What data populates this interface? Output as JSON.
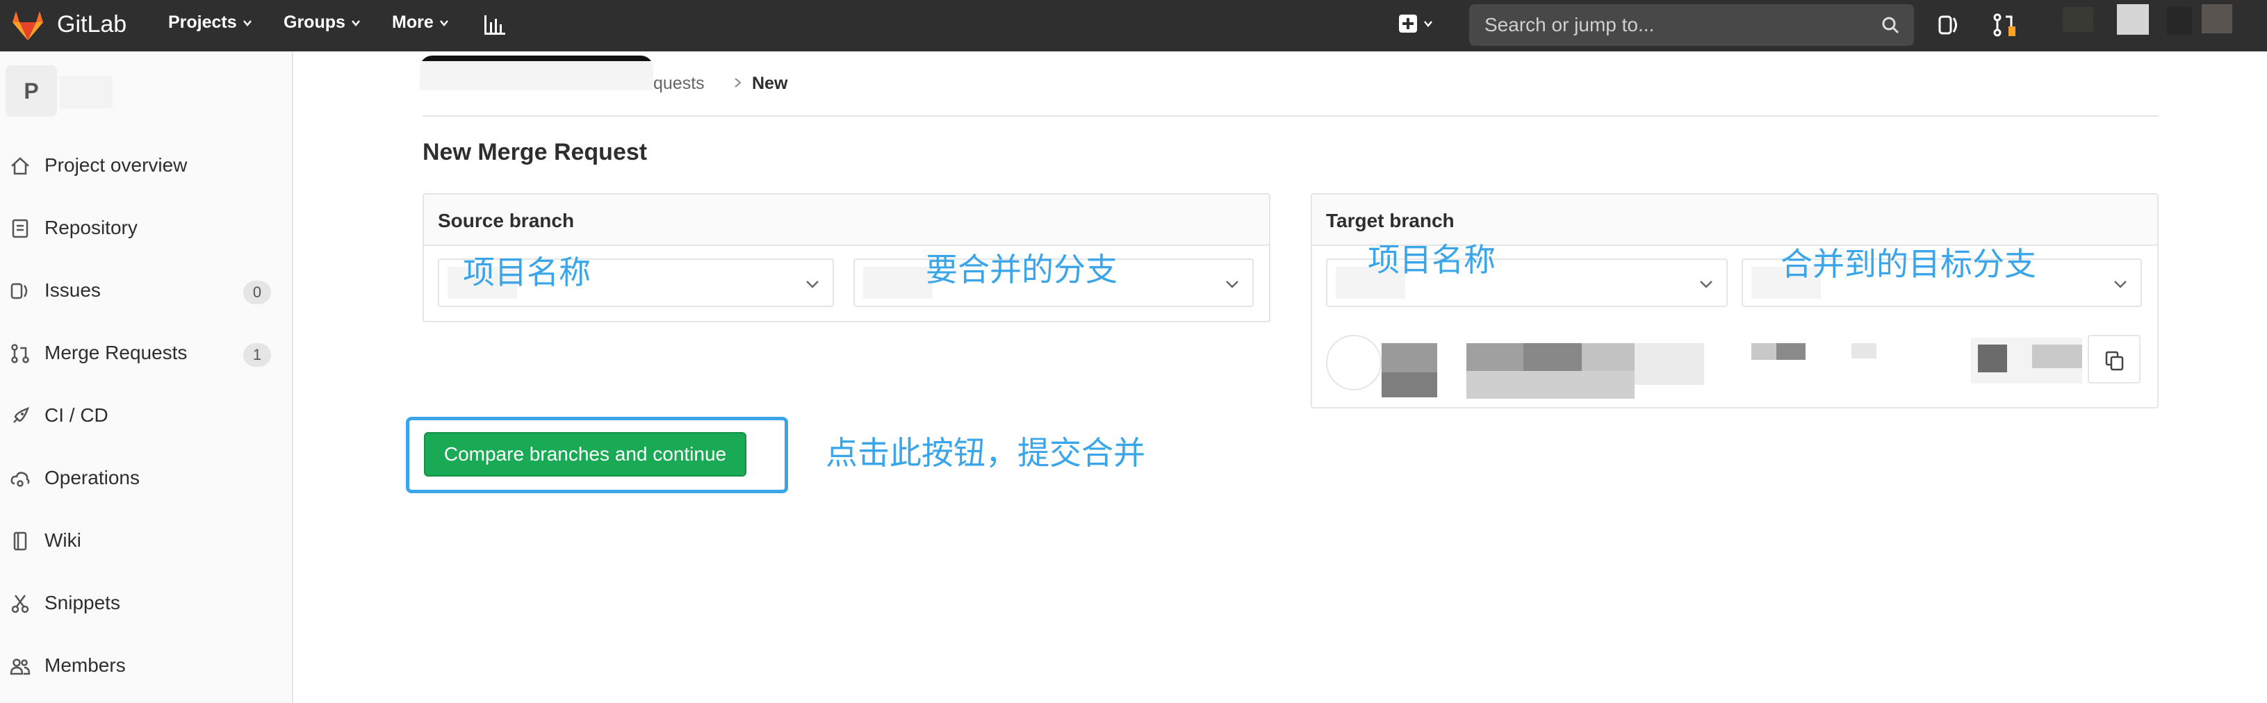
{
  "navbar": {
    "brand": "GitLab",
    "menus": [
      {
        "label": "Projects"
      },
      {
        "label": "Groups"
      },
      {
        "label": "More"
      }
    ],
    "search_placeholder": "Search or jump to..."
  },
  "sidebar": {
    "avatar_letter": "P",
    "items": [
      {
        "label": "Project overview",
        "icon": "home-icon"
      },
      {
        "label": "Repository",
        "icon": "document-icon"
      },
      {
        "label": "Issues",
        "icon": "issues-icon",
        "count": "0"
      },
      {
        "label": "Merge Requests",
        "icon": "merge-request-icon",
        "count": "1"
      },
      {
        "label": "CI / CD",
        "icon": "rocket-icon"
      },
      {
        "label": "Operations",
        "icon": "cloud-gear-icon"
      },
      {
        "label": "Wiki",
        "icon": "book-icon"
      },
      {
        "label": "Snippets",
        "icon": "scissors-icon"
      },
      {
        "label": "Members",
        "icon": "users-icon"
      }
    ]
  },
  "breadcrumb": {
    "parent": "quests",
    "current": "New"
  },
  "page_title": "New Merge Request",
  "source_panel": {
    "title": "Source branch"
  },
  "target_panel": {
    "title": "Target branch"
  },
  "annotations": {
    "source_project": "项目名称",
    "source_branch": "要合并的分支",
    "target_project": "项目名称",
    "target_branch": "合并到的目标分支",
    "submit_hint": "点击此按钮，提交合并"
  },
  "compare_button_label": "Compare branches and continue",
  "colors": {
    "navbar": "#2f2f2f",
    "annotation": "#3aa5e8",
    "primary_button": "#1aaa55"
  }
}
